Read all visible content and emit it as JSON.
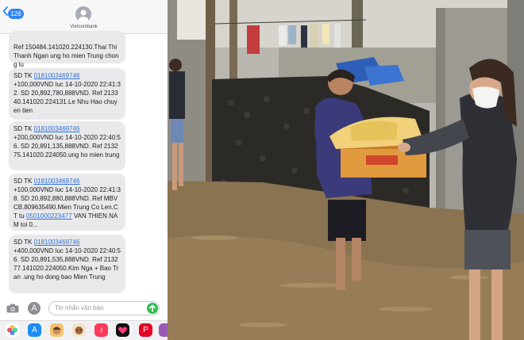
{
  "header": {
    "back_badge": "126",
    "contact_name": "Vietcombank"
  },
  "messages": [
    {
      "text": "Ref 150484.141020.224130.Thai Thi Thanh Ngan ung ho mien Trung chong lu"
    },
    {
      "account": "0181003469746",
      "text": "+100,000VND luc 14-10-2020 22:41:32. SD 20,892,780,888VND. Ref 213340.141020.224131.Le Nhu Hao chuyen tien"
    },
    {
      "account": "0181003469746",
      "text": "+200,000VND luc 14-10-2020 22:40:56. SD 20,891,135,888VND. Ref 213275.141020.224050.ung ho mien trung"
    },
    {
      "account": "0181003469746",
      "text_before": "+100,000VND luc 14-10-2020 22:41:38. SD 20,892,880,888VND. Ref MBVCB.809635490.Mien Trung Co Len.CT tu ",
      "link": "0501000223477",
      "text_after": " VAN THIEN NAM toi 0..."
    },
    {
      "account": "0181003469746",
      "text": "+400,000VND luc 14-10-2020 22:40:56. SD 20,891,535,888VND. Ref 213277.141020.224050.Kim Nga + Bao Tran .ung ho dong bao Mien Trung"
    }
  ],
  "composer": {
    "placeholder": "Tin nhắn văn bản"
  },
  "colors": {
    "bubble": "#e9e9eb",
    "link": "#2e71d9",
    "send": "#2fbd4f",
    "badge": "#2f86f6"
  },
  "app_drawer": [
    "photos-app",
    "app-store",
    "memoji",
    "animoji",
    "music",
    "heart-sticker",
    "pinterest",
    "more-app"
  ]
}
